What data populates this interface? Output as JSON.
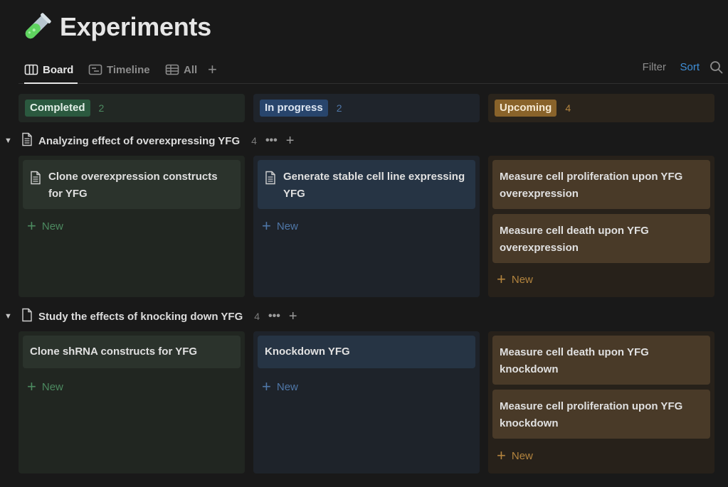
{
  "page": {
    "title": "Experiments",
    "icon": "test-tube-icon"
  },
  "tabs": [
    {
      "label": "Board",
      "icon": "board-icon",
      "active": true
    },
    {
      "label": "Timeline",
      "icon": "timeline-icon",
      "active": false
    },
    {
      "label": "All",
      "icon": "table-icon",
      "active": false
    }
  ],
  "toolbar": {
    "add_view": "+",
    "filter_label": "Filter",
    "sort_label": "Sort",
    "search_icon": "search-icon"
  },
  "columns": [
    {
      "label": "Completed",
      "count": "2",
      "color": "#2b593f"
    },
    {
      "label": "In progress",
      "count": "2",
      "color": "#28456c"
    },
    {
      "label": "Upcoming",
      "count": "4",
      "color": "#89632a"
    }
  ],
  "groups": [
    {
      "title": "Analyzing effect of overexpressing YFG",
      "count": "4",
      "cards": {
        "completed": [
          "Clone overexpression constructs for YFG"
        ],
        "in_progress": [
          "Generate stable cell line expressing YFG"
        ],
        "upcoming": [
          "Measure cell proliferation upon YFG overexpression",
          "Measure cell death upon YFG overexpression"
        ]
      }
    },
    {
      "title": "Study the effects of knocking down YFG",
      "count": "4",
      "cards": {
        "completed": [
          "Clone shRNA constructs for YFG"
        ],
        "in_progress": [
          "Knockdown YFG"
        ],
        "upcoming": [
          "Measure cell death upon YFG knockdown",
          "Measure cell proliferation upon YFG knockdown"
        ]
      }
    }
  ],
  "labels": {
    "new": "New",
    "more": "•••",
    "add": "+"
  },
  "colors": {
    "background": "#191919",
    "accent_sort": "#3f8fd8",
    "completed": "#2b593f",
    "in_progress": "#28456c",
    "upcoming": "#89632a"
  }
}
